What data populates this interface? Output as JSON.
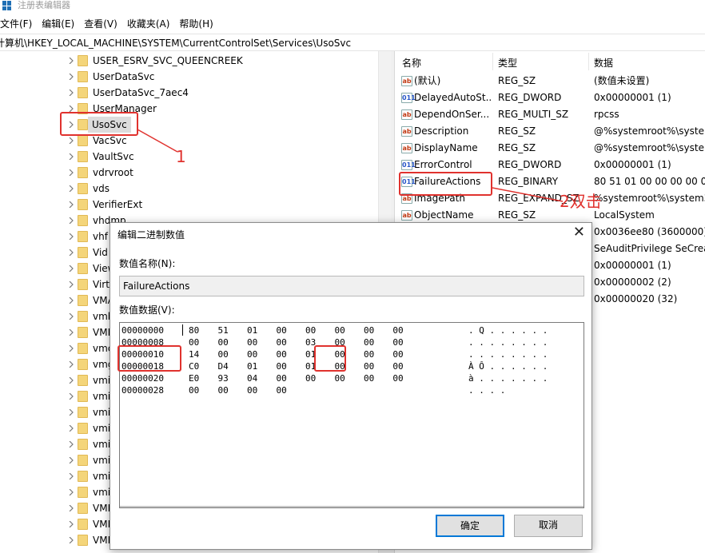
{
  "window": {
    "title": "注册表编辑器"
  },
  "menu": [
    "文件(F)",
    "编辑(E)",
    "查看(V)",
    "收藏夹(A)",
    "帮助(H)"
  ],
  "address": "计算机\\HKEY_LOCAL_MACHINE\\SYSTEM\\CurrentControlSet\\Services\\UsoSvc",
  "tree": {
    "items": [
      "USER_ESRV_SVC_QUEENCREEK",
      "UserDataSvc",
      "UserDataSvc_7aec4",
      "UserManager",
      "UsoSvc",
      "VacSvc",
      "VaultSvc",
      "vdrvroot",
      "vds",
      "VerifierExt",
      "vhdmp",
      "vhf",
      "Vid",
      "View",
      "Virt",
      "VMA",
      "vmb",
      "VMI",
      "vmc",
      "vmg",
      "vmi",
      "vmi",
      "vmi",
      "vmi",
      "vmi",
      "vmi",
      "vmi",
      "vmi",
      "VMI",
      "VMI",
      "VMI"
    ],
    "selected": "UsoSvc"
  },
  "list": {
    "headers": {
      "name": "名称",
      "type": "类型",
      "data": "数据"
    },
    "rows": [
      {
        "icon": "ab",
        "name": "(默认)",
        "type": "REG_SZ",
        "data": "(数值未设置)"
      },
      {
        "icon": "bin",
        "name": "DelayedAutoSt...",
        "type": "REG_DWORD",
        "data": "0x00000001 (1)"
      },
      {
        "icon": "ab",
        "name": "DependOnSer...",
        "type": "REG_MULTI_SZ",
        "data": "rpcss"
      },
      {
        "icon": "ab",
        "name": "Description",
        "type": "REG_SZ",
        "data": "@%systemroot%\\system"
      },
      {
        "icon": "ab",
        "name": "DisplayName",
        "type": "REG_SZ",
        "data": "@%systemroot%\\system"
      },
      {
        "icon": "bin",
        "name": "ErrorControl",
        "type": "REG_DWORD",
        "data": "0x00000001 (1)"
      },
      {
        "icon": "bin",
        "name": "FailureActions",
        "type": "REG_BINARY",
        "data": "80 51 01 00 00 00 00 00"
      },
      {
        "icon": "ab",
        "name": "ImagePath",
        "type": "REG_EXPAND_SZ",
        "data": "%systemroot%\\system3"
      },
      {
        "icon": "ab",
        "name": "ObjectName",
        "type": "REG_SZ",
        "data": "LocalSystem"
      }
    ],
    "extra_data": [
      "0x0036ee80 (3600000)",
      "SeAuditPrivilege SeCreat",
      "0x00000001 (1)",
      "0x00000002 (2)",
      "0x00000020 (32)"
    ]
  },
  "annotations": {
    "step1": "1",
    "step2": "2双击"
  },
  "dialog": {
    "title": "编辑二进制数值",
    "close": "✕",
    "name_label": "数值名称(N):",
    "name_value": "FailureActions",
    "data_label": "数值数据(V):",
    "hex_rows": [
      {
        "offset": "00000000",
        "bytes": "80  51  01  00  00  00  00  00",
        "ascii": ". Q . . . . . ."
      },
      {
        "offset": "00000008",
        "bytes": "00  00  00  00  03  00  00  00",
        "ascii": ". . . . . . . ."
      },
      {
        "offset": "00000010",
        "bytes": "14  00  00  00  01  00  00  00",
        "ascii": ". . . . . . . ."
      },
      {
        "offset": "00000018",
        "bytes": "C0  D4  01  00  01  00  00  00",
        "ascii": "À Ô . . . . . ."
      },
      {
        "offset": "00000020",
        "bytes": "E0  93  04  00  00  00  00  00",
        "ascii": "à . . . . . . ."
      },
      {
        "offset": "00000028",
        "bytes": "00  00  00  00",
        "ascii": ". . . ."
      }
    ],
    "ok": "确定",
    "cancel": "取消"
  },
  "colors": {
    "highlight": "#e0322e",
    "focus": "#0078d7",
    "folder": "#f4d57a"
  }
}
